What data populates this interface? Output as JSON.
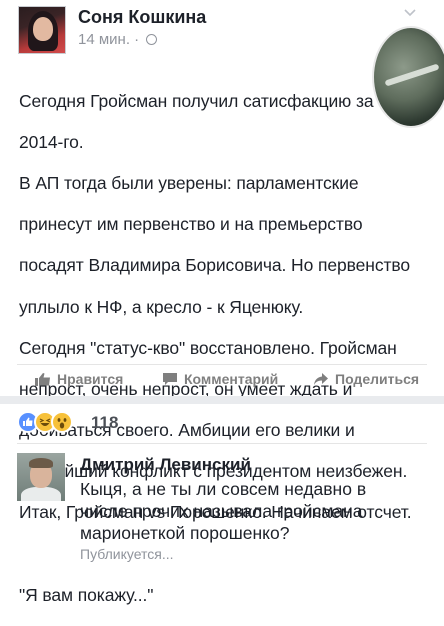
{
  "post": {
    "author": "Соня Кошкина",
    "time": "14 мин.",
    "separator": "·",
    "text_lines": [
      "Сегодня Гройсман получил сатисфакцию за",
      "2014-го.",
      "В АП тогда были уверены: парламентские",
      "принесут им первенство и на премьерство",
      "посадят Владимира Борисовича. Но первенство",
      "уплыло к НФ, а кресло - к Яценюку.",
      "Сегодня \"статус-кво\"  восстановлено. Гройсман",
      "непрост, очень непрост, он умеет ждать и",
      "добиваться своего. Амбиции его велики и",
      "острейший конфликт с президентом неизбежен.",
      "Итак, Гройсман vs Порошенко. Начинаем отсчет.",
      "",
      "\"Я вам покажу...\""
    ]
  },
  "actions": {
    "like_label": "Нравится",
    "comment_label": "Комментарий",
    "share_label": "Поделиться"
  },
  "reactions": {
    "icons": [
      "like-reaction-icon",
      "haha-reaction-icon",
      "wow-reaction-icon"
    ],
    "count": "118"
  },
  "comment": {
    "author": "Дмитрий Левинский",
    "text_lines": [
      "Кыця, а не ты ли совсем недавно в",
      "числе прочих называла гройсмана",
      "марионеткой порошенко?"
    ],
    "status": "Публикуется..."
  },
  "colors": {
    "text": "#1d2129",
    "secondary": "#90949c",
    "action_grey": "#7f7f7f",
    "like_blue": "#5890ff",
    "reaction_yellow": "#f7c13a",
    "separator_band": "#e9ebee"
  }
}
